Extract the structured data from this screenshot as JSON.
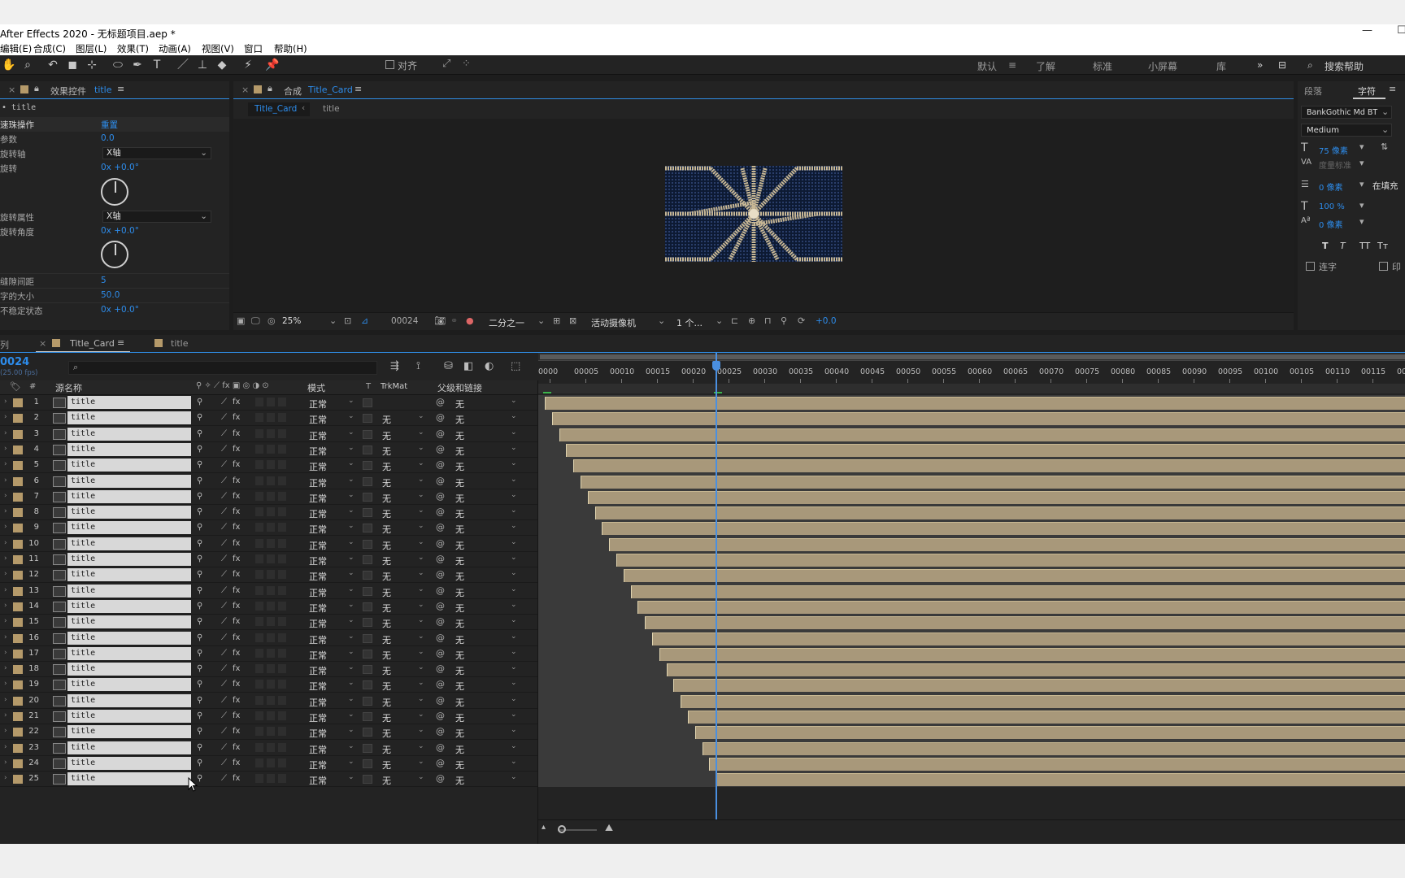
{
  "window": {
    "title": "After Effects 2020 - 无标题项目.aep *"
  },
  "menu": [
    "编辑(E)",
    "合成(C)",
    "图层(L)",
    "效果(T)",
    "动画(A)",
    "视图(V)",
    "窗口",
    "帮助(H)"
  ],
  "toolbar": {
    "snap_label": "对齐",
    "search_placeholder": "搜索帮助"
  },
  "workspaces": [
    "默认",
    "了解",
    "标准",
    "小屏幕",
    "库"
  ],
  "effect_controls": {
    "tab_label": "效果控件",
    "tab_layer": "title",
    "layer_path": "• title",
    "rows": [
      {
        "label": "速珠操作",
        "value": "重置"
      },
      {
        "label": "参数",
        "value": "0.0"
      },
      {
        "label": "旋转轴",
        "dropdown": "X轴"
      },
      {
        "label": "旋转",
        "value": "0x +0.0°"
      },
      {
        "label": "旋转属性",
        "dropdown": "X轴"
      },
      {
        "label": "旋转角度",
        "value": "0x +0.0°"
      },
      {
        "label": "缝隙间距",
        "value": "5"
      },
      {
        "label": "字的大小",
        "value": "50.0"
      },
      {
        "label": "不稳定状态",
        "value": "0x +0.0°"
      }
    ]
  },
  "composition": {
    "tab_label": "合成",
    "tab_name": "Title_Card",
    "breadcrumb_active": "Title_Card",
    "breadcrumb_next": "title",
    "footer": {
      "zoom": "25%",
      "timecode": "00024",
      "resolution": "二分之一",
      "camera": "活动摄像机",
      "views": "1 个...",
      "exposure": "+0.0"
    }
  },
  "character_panel": {
    "tab_paragraph": "段落",
    "tab_character": "字符",
    "font": "BankGothic Md BT",
    "style": "Medium",
    "size": "75 像素",
    "kerning": "度量标准",
    "stroke": "0 像素",
    "stroke_mode": "在填充",
    "vscale": "100 %",
    "baseline": "0 像素",
    "ligature": "连字",
    "faux": "印"
  },
  "timeline": {
    "left_tab": "列",
    "tab_label": "Title_Card",
    "tab_other": "title",
    "timecode": "0024",
    "fps": "(25.00 fps)",
    "headers": {
      "num": "#",
      "source": "源名称",
      "mode": "模式",
      "t": "T",
      "trkmat": "TrkMat",
      "parent": "父级和链接"
    },
    "ruler": [
      "0000",
      "00005",
      "00010",
      "00015",
      "00020",
      "00025",
      "00030",
      "00035",
      "00040",
      "00045",
      "00050",
      "00055",
      "00060",
      "00065",
      "00070",
      "00075",
      "00080",
      "00085",
      "00090",
      "00095",
      "00100",
      "00105",
      "00110",
      "00115",
      "001"
    ],
    "playhead_frame": 24,
    "layers": [
      {
        "num": "1",
        "name": "title",
        "mode": "正常",
        "trkmat": "",
        "parent": "无",
        "start": 0
      },
      {
        "num": "2",
        "name": "title",
        "mode": "正常",
        "trkmat": "无",
        "parent": "无",
        "start": 1
      },
      {
        "num": "3",
        "name": "title",
        "mode": "正常",
        "trkmat": "无",
        "parent": "无",
        "start": 2
      },
      {
        "num": "4",
        "name": "title",
        "mode": "正常",
        "trkmat": "无",
        "parent": "无",
        "start": 3
      },
      {
        "num": "5",
        "name": "title",
        "mode": "正常",
        "trkmat": "无",
        "parent": "无",
        "start": 4
      },
      {
        "num": "6",
        "name": "title",
        "mode": "正常",
        "trkmat": "无",
        "parent": "无",
        "start": 5
      },
      {
        "num": "7",
        "name": "title",
        "mode": "正常",
        "trkmat": "无",
        "parent": "无",
        "start": 6
      },
      {
        "num": "8",
        "name": "title",
        "mode": "正常",
        "trkmat": "无",
        "parent": "无",
        "start": 7
      },
      {
        "num": "9",
        "name": "title",
        "mode": "正常",
        "trkmat": "无",
        "parent": "无",
        "start": 8
      },
      {
        "num": "10",
        "name": "title",
        "mode": "正常",
        "trkmat": "无",
        "parent": "无",
        "start": 9
      },
      {
        "num": "11",
        "name": "title",
        "mode": "正常",
        "trkmat": "无",
        "parent": "无",
        "start": 10
      },
      {
        "num": "12",
        "name": "title",
        "mode": "正常",
        "trkmat": "无",
        "parent": "无",
        "start": 11
      },
      {
        "num": "13",
        "name": "title",
        "mode": "正常",
        "trkmat": "无",
        "parent": "无",
        "start": 12
      },
      {
        "num": "14",
        "name": "title",
        "mode": "正常",
        "trkmat": "无",
        "parent": "无",
        "start": 13
      },
      {
        "num": "15",
        "name": "title",
        "mode": "正常",
        "trkmat": "无",
        "parent": "无",
        "start": 14
      },
      {
        "num": "16",
        "name": "title",
        "mode": "正常",
        "trkmat": "无",
        "parent": "无",
        "start": 15
      },
      {
        "num": "17",
        "name": "title",
        "mode": "正常",
        "trkmat": "无",
        "parent": "无",
        "start": 16
      },
      {
        "num": "18",
        "name": "title",
        "mode": "正常",
        "trkmat": "无",
        "parent": "无",
        "start": 17
      },
      {
        "num": "19",
        "name": "title",
        "mode": "正常",
        "trkmat": "无",
        "parent": "无",
        "start": 18
      },
      {
        "num": "20",
        "name": "title",
        "mode": "正常",
        "trkmat": "无",
        "parent": "无",
        "start": 19
      },
      {
        "num": "21",
        "name": "title",
        "mode": "正常",
        "trkmat": "无",
        "parent": "无",
        "start": 20
      },
      {
        "num": "22",
        "name": "title",
        "mode": "正常",
        "trkmat": "无",
        "parent": "无",
        "start": 21
      },
      {
        "num": "23",
        "name": "title",
        "mode": "正常",
        "trkmat": "无",
        "parent": "无",
        "start": 22
      },
      {
        "num": "24",
        "name": "title",
        "mode": "正常",
        "trkmat": "无",
        "parent": "无",
        "start": 23
      },
      {
        "num": "25",
        "name": "title",
        "mode": "正常",
        "trkmat": "无",
        "parent": "无",
        "start": 24
      }
    ]
  },
  "colors": {
    "accent": "#2d8ceb",
    "label": "#b59a6a",
    "bar": "#a8987a",
    "panel": "#232323"
  }
}
